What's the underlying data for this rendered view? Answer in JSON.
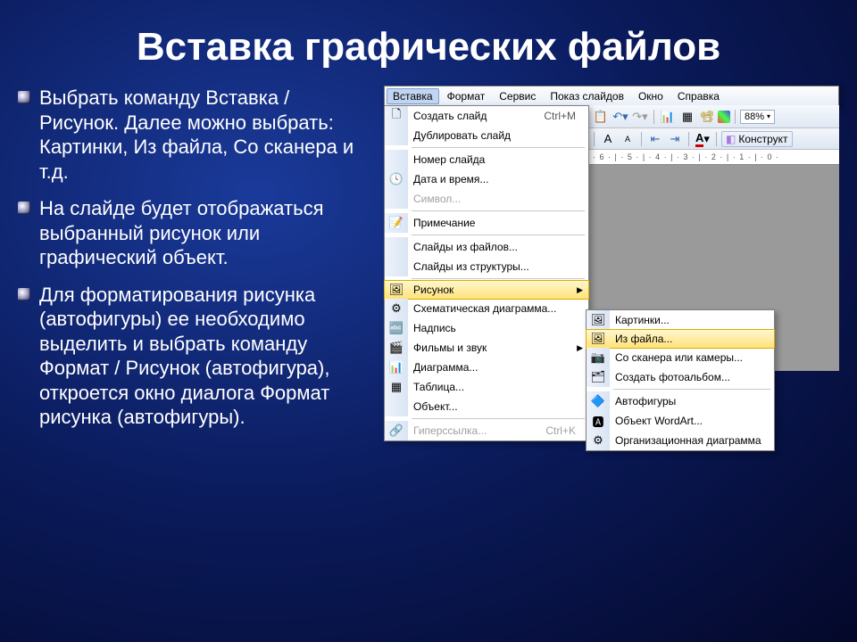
{
  "slide": {
    "title": "Вставка графических файлов",
    "bullets": [
      "Выбрать команду Вставка / Рисунок. Далее можно выбрать: Картинки, Из файла, Со сканера и т.д.",
      "На слайде будет отображаться выбранный рисунок или графический объект.",
      " Для форматирования рисунка (автофигуры) ее необходимо выделить и выбрать команду Формат / Рисунок (автофигура), откроется окно диалога Формат рисунка (автофигуры)."
    ]
  },
  "app": {
    "menubar": [
      "Вставка",
      "Формат",
      "Сервис",
      "Показ слайдов",
      "Окно",
      "Справка"
    ],
    "active_menu_index": 0,
    "zoom": "88%",
    "konstruktor": "Конструкт",
    "ruler_text": "· 6 · | · 5 · | · 4 · | · 3 · | · 2 · | · 1 · | · 0 ·",
    "dropdown": [
      {
        "icon": "🗋",
        "label": "Создать слайд",
        "shortcut": "Ctrl+M"
      },
      {
        "icon": "",
        "label": "Дублировать слайд"
      },
      {
        "sep": true
      },
      {
        "icon": "",
        "label": "Номер слайда"
      },
      {
        "icon": "🕓",
        "label": "Дата и время..."
      },
      {
        "icon": "",
        "label": "Символ...",
        "disabled": true
      },
      {
        "sep": true
      },
      {
        "icon": "📝",
        "label": "Примечание"
      },
      {
        "sep": true
      },
      {
        "icon": "",
        "label": "Слайды из файлов..."
      },
      {
        "icon": "",
        "label": "Слайды из структуры..."
      },
      {
        "sep": true
      },
      {
        "icon": "🖼",
        "label": "Рисунок",
        "arrow": true,
        "highlighted": true
      },
      {
        "icon": "⚙",
        "label": "Схематическая диаграмма..."
      },
      {
        "icon": "🔤",
        "label": "Надпись"
      },
      {
        "icon": "🎬",
        "label": "Фильмы и звук",
        "arrow": true
      },
      {
        "icon": "📊",
        "label": "Диаграмма..."
      },
      {
        "icon": "▦",
        "label": "Таблица..."
      },
      {
        "icon": "",
        "label": "Объект..."
      },
      {
        "sep": true
      },
      {
        "icon": "🔗",
        "label": "Гиперссылка...",
        "shortcut": "Ctrl+K",
        "disabled": true
      }
    ],
    "submenu": [
      {
        "icon": "🖼",
        "label": "Картинки..."
      },
      {
        "icon": "🖼",
        "label": "Из файла...",
        "highlighted": true
      },
      {
        "icon": "📷",
        "label": "Со сканера или камеры..."
      },
      {
        "icon": "🗂",
        "label": "Создать фотоальбом..."
      },
      {
        "sep": true
      },
      {
        "icon": "🔷",
        "label": "Автофигуры"
      },
      {
        "icon": "🅰",
        "label": "Объект WordArt..."
      },
      {
        "icon": "⚙",
        "label": "Организационная диаграмма"
      }
    ]
  }
}
